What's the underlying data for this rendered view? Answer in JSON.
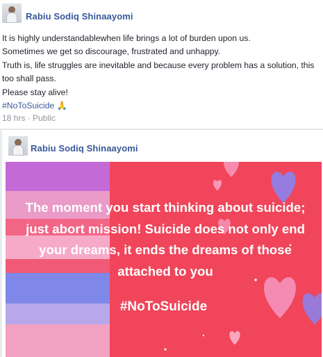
{
  "post": {
    "author_name": "Rabiu Sodiq Shinaayomi",
    "lines": [
      "It is highly understandablewhen life brings a lot of burden upon us.",
      "Sometimes we get so discourage, frustrated and unhappy.",
      "Truth is, life struggles are inevitable and because every problem has a solution, this too shall pass.",
      "Please stay alive!"
    ],
    "hashtag": "#NoToSuicide",
    "emoji": "🙏",
    "timestamp": "18 hrs",
    "separator": "·",
    "privacy": "Public"
  },
  "shared": {
    "author_name": "Rabiu Sodiq Shinaayomi",
    "quote": "The moment you start thinking about suicide; just abort mission! Suicide does not only end your dreams, it ends the dreams of those attached to you",
    "hashtag": "#NoToSuicide"
  },
  "colors": {
    "link": "#365899",
    "image_background": "#f0455a",
    "heart_pink": "#f78fb3",
    "heart_purple": "#8f7fe6"
  }
}
